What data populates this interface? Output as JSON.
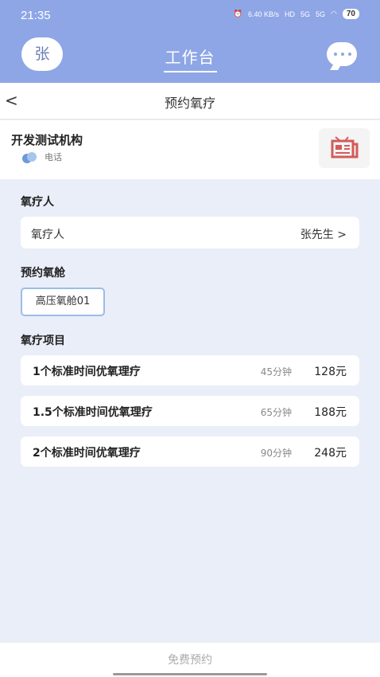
{
  "status_bar": {
    "time": "21:35",
    "net_speed": "6.40 KB/s",
    "hd": "HD",
    "sig1": "5G",
    "sig2": "5G",
    "battery": "70"
  },
  "header": {
    "avatar_text": "张",
    "title": "工作台"
  },
  "nav": {
    "back": "<",
    "title": "预约氧疗"
  },
  "org": {
    "name": "开发测试机构",
    "phone_label": "电话"
  },
  "patient_section": {
    "label": "氧疗人",
    "field_label": "氧疗人",
    "field_value": "张先生 >"
  },
  "chamber_section": {
    "label": "预约氧舱",
    "options": [
      "高压氧舱01"
    ]
  },
  "items_section": {
    "label": "氧疗项目",
    "items": [
      {
        "name": "1个标准时间优氧理疗",
        "duration": "45分钟",
        "price": "128元"
      },
      {
        "name": "1.5个标准时间优氧理疗",
        "duration": "65分钟",
        "price": "188元"
      },
      {
        "name": "2个标准时间优氧理疗",
        "duration": "90分钟",
        "price": "248元"
      }
    ]
  },
  "footer": {
    "submit_label": "免费预约"
  },
  "colors": {
    "header_bg": "#8ea6e6",
    "page_bg": "#e9eef9",
    "chamber_border": "#9bbde8",
    "news_icon": "#d45b5b"
  }
}
